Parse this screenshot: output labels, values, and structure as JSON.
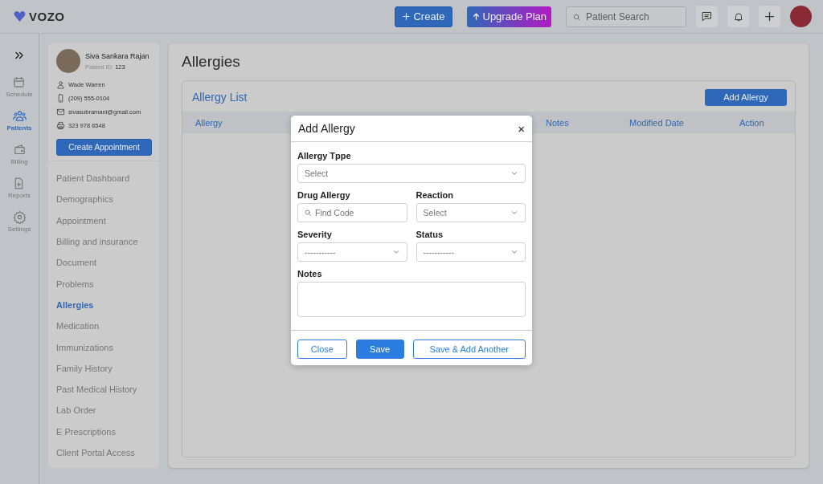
{
  "topbar": {
    "logo": "VOZO",
    "create_button": "Create",
    "upgrade_button": "Upgrade Plan",
    "search": {
      "placeholder": "Patient Search"
    }
  },
  "rail": {
    "items": [
      {
        "label": "Schedule",
        "kind": "calendar",
        "selected": false
      },
      {
        "label": "Patients",
        "kind": "people",
        "selected": true
      },
      {
        "label": "Billing",
        "kind": "wallet",
        "selected": false
      },
      {
        "label": "Reports",
        "kind": "report",
        "selected": false
      },
      {
        "label": "Settings",
        "kind": "gear",
        "selected": false
      }
    ]
  },
  "patient": {
    "name": "Siva Sankara Rajan",
    "id_label": "Patient ID:",
    "id_value": "123",
    "contacts": [
      {
        "kind": "person",
        "text": "Wade Warren"
      },
      {
        "kind": "phone",
        "text": "(209) 555-0104"
      },
      {
        "kind": "email",
        "text": "sivasubramani@gmail.com"
      },
      {
        "kind": "fax",
        "text": "323 978 6548"
      }
    ],
    "create_appointment_button": "Create Appointment"
  },
  "nav": {
    "items": [
      {
        "label": "Patient Dashboard",
        "selected": false
      },
      {
        "label": "Demographics",
        "selected": false
      },
      {
        "label": "Appointment",
        "selected": false
      },
      {
        "label": "Billing and insurance",
        "selected": false
      },
      {
        "label": "Document",
        "selected": false
      },
      {
        "label": "Problems",
        "selected": false
      },
      {
        "label": "Allergies",
        "selected": true
      },
      {
        "label": "Medication",
        "selected": false
      },
      {
        "label": "Immunizations",
        "selected": false
      },
      {
        "label": "Family History",
        "selected": false
      },
      {
        "label": "Past Medical History",
        "selected": false
      },
      {
        "label": "Lab Order",
        "selected": false
      },
      {
        "label": "E Prescriptions",
        "selected": false
      },
      {
        "label": "Client Portal Access",
        "selected": false
      }
    ]
  },
  "page": {
    "title": "Allergies",
    "panel_title": "Allergy List",
    "add_button": "Add Allergy",
    "table": {
      "columns": [
        "Allergy",
        "Notes",
        "Modified Date",
        "Action"
      ]
    }
  },
  "dialog": {
    "title": "Add Allergy",
    "close": "×",
    "fields": [
      {
        "label": "Allergy Tppe",
        "kind": "select",
        "placeholder": "Select",
        "wide": true
      },
      {
        "label": "Drug Allergy",
        "kind": "search",
        "placeholder": "Find Code",
        "wide": false
      },
      {
        "label": "Reaction",
        "kind": "select",
        "placeholder": "Select",
        "wide": false
      },
      {
        "label": "Severity",
        "kind": "select",
        "value": "-----------",
        "wide": false
      },
      {
        "label": "Status",
        "kind": "select",
        "value": "-----------",
        "wide": false
      },
      {
        "label": "Notes",
        "kind": "textarea",
        "wide": true
      }
    ],
    "buttons": [
      {
        "label": "Close",
        "kind": "outline"
      },
      {
        "label": "Save",
        "kind": "primary"
      },
      {
        "label": "Save & Add Another",
        "kind": "outline"
      }
    ]
  }
}
